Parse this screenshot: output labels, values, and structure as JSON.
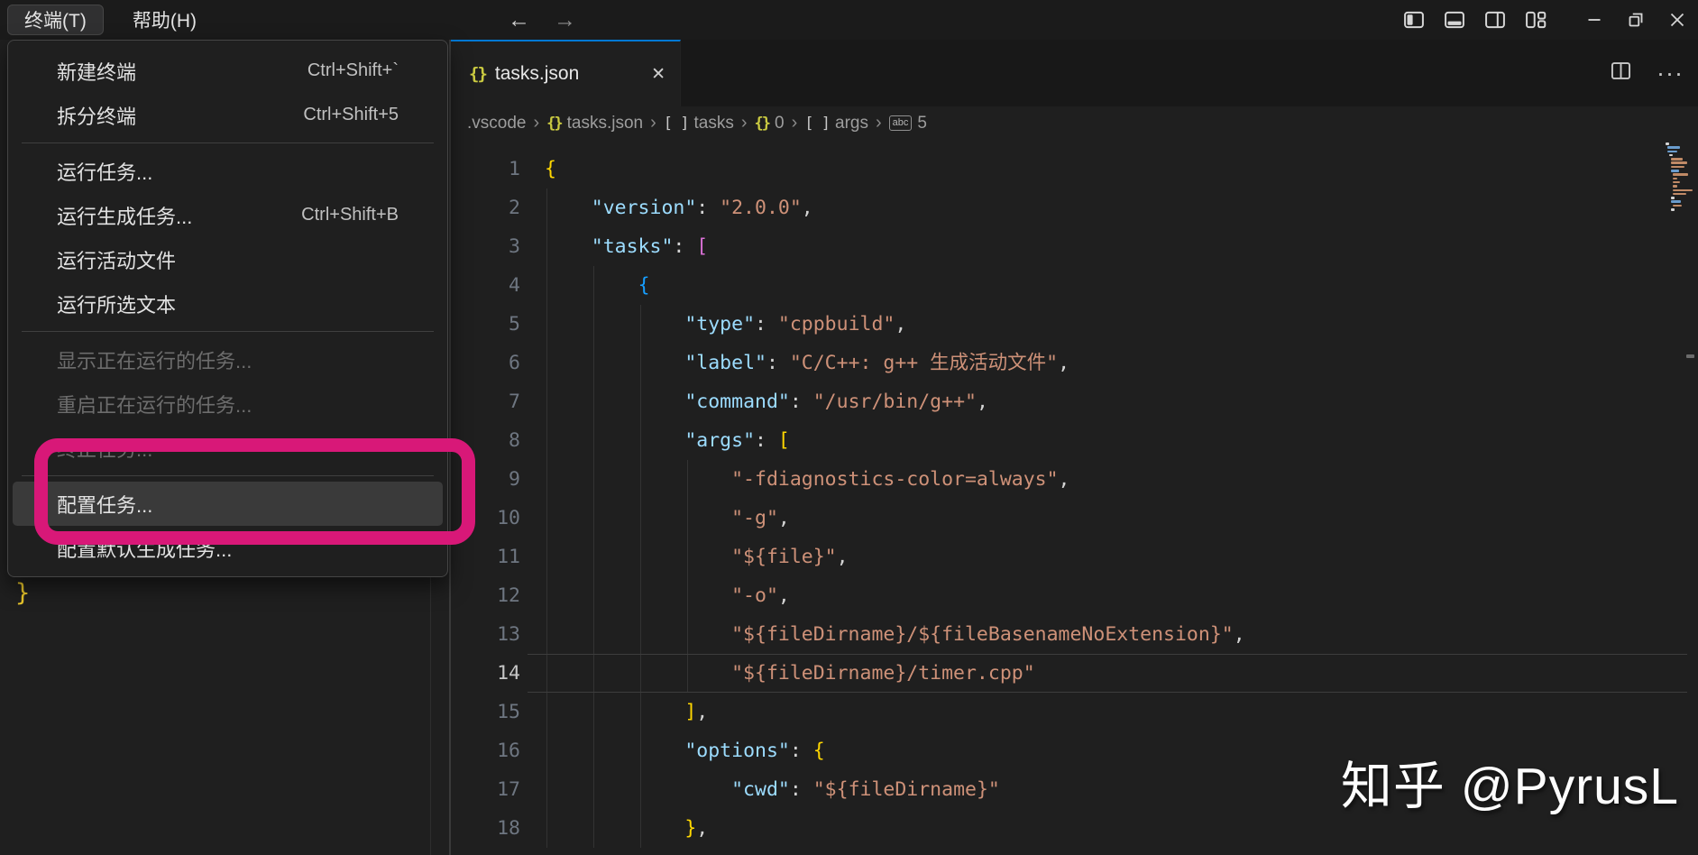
{
  "titlebar": {
    "menus": [
      {
        "label": "终端(T)",
        "active": true
      },
      {
        "label": "帮助(H)",
        "active": false
      }
    ],
    "back": "←",
    "forward": "→"
  },
  "terminal_menu": {
    "items": [
      {
        "label": "新建终端",
        "shortcut": "Ctrl+Shift+`"
      },
      {
        "label": "拆分终端",
        "shortcut": "Ctrl+Shift+5"
      },
      {
        "sep": true
      },
      {
        "label": "运行任务..."
      },
      {
        "label": "运行生成任务...",
        "shortcut": "Ctrl+Shift+B"
      },
      {
        "label": "运行活动文件"
      },
      {
        "label": "运行所选文本"
      },
      {
        "sep": true
      },
      {
        "label": "显示正在运行的任务...",
        "disabled": true
      },
      {
        "label": "重启正在运行的任务...",
        "disabled": true
      },
      {
        "label": "终止任务...",
        "disabled": true
      },
      {
        "sep": true
      },
      {
        "label": "配置任务...",
        "highlighted": true
      },
      {
        "label": "配置默认生成任务..."
      }
    ]
  },
  "editor": {
    "tab": {
      "icon": "{}",
      "label": "tasks.json",
      "close": "✕"
    },
    "actions": {
      "more": "···"
    },
    "breadcrumb": {
      "separator": "›",
      "items": [
        {
          "label": ".vscode"
        },
        {
          "icon": "braces",
          "icon_color": "#cbcb41",
          "label": "tasks.json"
        },
        {
          "icon": "brackets",
          "label": "tasks"
        },
        {
          "icon": "braces",
          "icon_color": "#cbcb41",
          "label": "0"
        },
        {
          "icon": "brackets",
          "label": "args"
        },
        {
          "icon": "abc",
          "label": "5"
        }
      ]
    },
    "code": {
      "current_line": 14,
      "lines": [
        [
          [
            "{",
            "y"
          ]
        ],
        [
          [
            "    ",
            "p"
          ],
          [
            "\"version\"",
            "k"
          ],
          [
            ": ",
            "p"
          ],
          [
            "\"2.0.0\"",
            "s"
          ],
          [
            ",",
            "p"
          ]
        ],
        [
          [
            "    ",
            "p"
          ],
          [
            "\"tasks\"",
            "k"
          ],
          [
            ": ",
            "p"
          ],
          [
            "[",
            "m"
          ]
        ],
        [
          [
            "        ",
            "p"
          ],
          [
            "{",
            "b"
          ]
        ],
        [
          [
            "            ",
            "p"
          ],
          [
            "\"type\"",
            "k"
          ],
          [
            ": ",
            "p"
          ],
          [
            "\"cppbuild\"",
            "s"
          ],
          [
            ",",
            "p"
          ]
        ],
        [
          [
            "            ",
            "p"
          ],
          [
            "\"label\"",
            "k"
          ],
          [
            ": ",
            "p"
          ],
          [
            "\"C/C++: g++ 生成活动文件\"",
            "s"
          ],
          [
            ",",
            "p"
          ]
        ],
        [
          [
            "            ",
            "p"
          ],
          [
            "\"command\"",
            "k"
          ],
          [
            ": ",
            "p"
          ],
          [
            "\"/usr/bin/g++\"",
            "s"
          ],
          [
            ",",
            "p"
          ]
        ],
        [
          [
            "            ",
            "p"
          ],
          [
            "\"args\"",
            "k"
          ],
          [
            ": ",
            "p"
          ],
          [
            "[",
            "y"
          ]
        ],
        [
          [
            "                ",
            "p"
          ],
          [
            "\"-fdiagnostics-color=always\"",
            "s"
          ],
          [
            ",",
            "p"
          ]
        ],
        [
          [
            "                ",
            "p"
          ],
          [
            "\"-g\"",
            "s"
          ],
          [
            ",",
            "p"
          ]
        ],
        [
          [
            "                ",
            "p"
          ],
          [
            "\"${file}\"",
            "s"
          ],
          [
            ",",
            "p"
          ]
        ],
        [
          [
            "                ",
            "p"
          ],
          [
            "\"-o\"",
            "s"
          ],
          [
            ",",
            "p"
          ]
        ],
        [
          [
            "                ",
            "p"
          ],
          [
            "\"${fileDirname}/${fileBasenameNoExtension}\"",
            "s"
          ],
          [
            ",",
            "p"
          ]
        ],
        [
          [
            "                ",
            "p"
          ],
          [
            "\"${fileDirname}/timer.cpp\"",
            "s"
          ]
        ],
        [
          [
            "            ",
            "p"
          ],
          [
            "]",
            "y"
          ],
          [
            ",",
            "p"
          ]
        ],
        [
          [
            "            ",
            "p"
          ],
          [
            "\"options\"",
            "k"
          ],
          [
            ": ",
            "p"
          ],
          [
            "{",
            "y"
          ]
        ],
        [
          [
            "                ",
            "p"
          ],
          [
            "\"cwd\"",
            "k"
          ],
          [
            ": ",
            "p"
          ],
          [
            "\"${fileDirname}\"",
            "s"
          ]
        ],
        [
          [
            "            ",
            "p"
          ],
          [
            "}",
            "y"
          ],
          [
            ",",
            "p"
          ]
        ]
      ]
    },
    "minimap_rows": [
      {
        "x": 0,
        "w": 4,
        "c": "#d4d4d4"
      },
      {
        "x": 2,
        "w": 14,
        "c": "#6a9ccd"
      },
      {
        "x": 2,
        "w": 11,
        "c": "#6a9ccd"
      },
      {
        "x": 4,
        "w": 4,
        "c": "#d4d4d4"
      },
      {
        "x": 6,
        "w": 13,
        "c": "#c08a66"
      },
      {
        "x": 6,
        "w": 18,
        "c": "#c08a66"
      },
      {
        "x": 6,
        "w": 15,
        "c": "#c08a66"
      },
      {
        "x": 6,
        "w": 9,
        "c": "#6a9ccd"
      },
      {
        "x": 8,
        "w": 17,
        "c": "#c08a66"
      },
      {
        "x": 8,
        "w": 5,
        "c": "#c08a66"
      },
      {
        "x": 8,
        "w": 8,
        "c": "#c08a66"
      },
      {
        "x": 8,
        "w": 5,
        "c": "#c08a66"
      },
      {
        "x": 8,
        "w": 22,
        "c": "#c08a66"
      },
      {
        "x": 8,
        "w": 15,
        "c": "#c08a66"
      },
      {
        "x": 6,
        "w": 4,
        "c": "#d4d4d4"
      },
      {
        "x": 6,
        "w": 11,
        "c": "#6a9ccd"
      },
      {
        "x": 8,
        "w": 10,
        "c": "#c08a66"
      },
      {
        "x": 6,
        "w": 4,
        "c": "#d4d4d4"
      }
    ]
  },
  "left_editor": {
    "fragment": "}"
  },
  "watermark": {
    "text": "知乎 @PyrusL"
  },
  "colors": {
    "editor_bg": "#1f1f1f",
    "tabstrip_bg": "#181818",
    "titlebar_bg": "#1b1b1b",
    "active_tab_accent": "#0078d4",
    "annotation_pink": "#d81878",
    "json_key": "#9cdcfe",
    "json_string": "#ce9178",
    "bracket_level1": "#ffd700",
    "bracket_level2": "#da70d6",
    "bracket_level3": "#179fff",
    "json_file_icon": "#cbcb41"
  }
}
